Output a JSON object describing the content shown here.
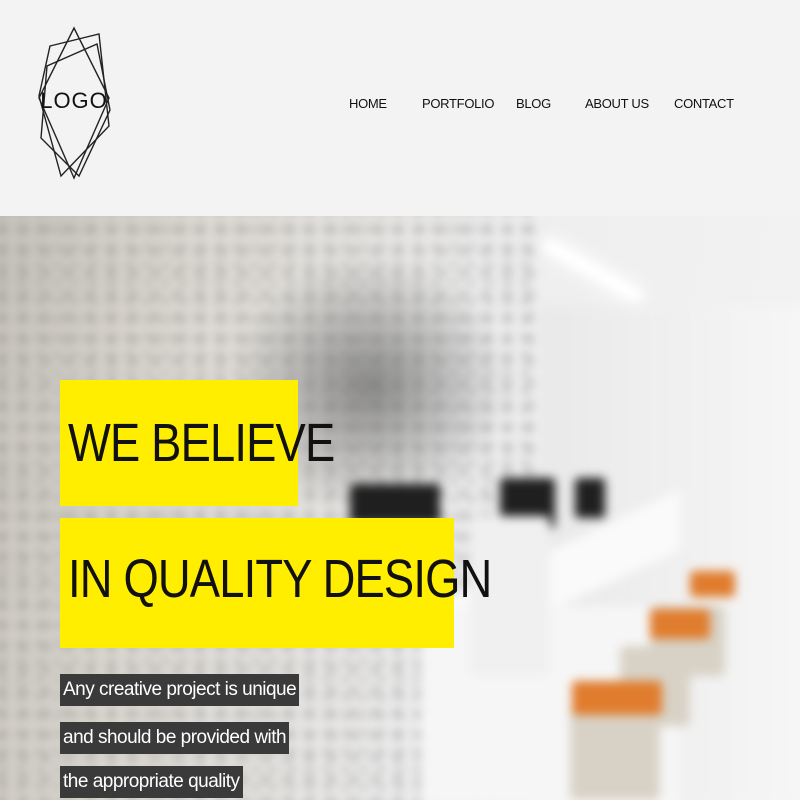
{
  "logo": {
    "text": "LOGO",
    "icon": "hexagram-outline"
  },
  "nav": {
    "items": [
      {
        "label": "HOME"
      },
      {
        "label": "PORTFOLIO"
      },
      {
        "label": "BLOG"
      },
      {
        "label": "ABOUT US"
      },
      {
        "label": "CONTACT"
      }
    ]
  },
  "hero": {
    "headline_line_1": "WE BELIEVE",
    "headline_line_2": "IN QUALITY DESIGN",
    "tagline_lines": [
      "Any creative project is unique",
      "and should be provided with",
      "the appropriate quality"
    ],
    "background": "blurred-office-interior"
  },
  "colors": {
    "accent_yellow": "#ffee00",
    "tagline_bg": "#3a3a3a",
    "header_bg": "#f3f3f3"
  }
}
